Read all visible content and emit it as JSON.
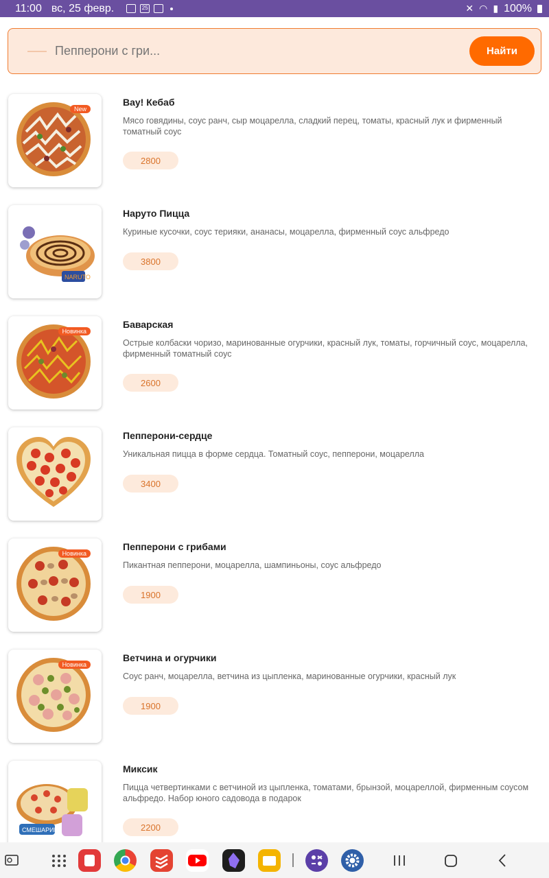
{
  "status": {
    "time": "11:00",
    "date": "вс, 25 февр.",
    "battery": "100%",
    "calendar_day": "25"
  },
  "search": {
    "placeholder": "Пепперони с гри...",
    "button_label": "Найти"
  },
  "products": [
    {
      "title": "Вау! Кебаб",
      "description": "Мясо говядины, соус ранч, сыр моцарелла, сладкий перец, томаты, красный лук и фирменный томатный соус",
      "price": "2800",
      "badge": "New",
      "image": "pizza-kebab"
    },
    {
      "title": "Наруто Пицца",
      "description": "Куриные кусочки, соус терияки, ананасы, моцарелла, фирменный соус альфредо",
      "price": "3800",
      "badge": "",
      "image": "pizza-naruto"
    },
    {
      "title": "Баварская",
      "description": "Острые колбаски чоризо, маринованные огурчики, красный лук, томаты, горчичный соус, моцарелла, фирменный томатный соус",
      "price": "2600",
      "badge": "Новинка",
      "image": "pizza-bavarian"
    },
    {
      "title": "Пепперони-сердце",
      "description": "Уникальная пицца в форме сердца. Томатный соус, пепперони, моцарелла",
      "price": "3400",
      "badge": "",
      "image": "pizza-heart"
    },
    {
      "title": "Пепперони с грибами",
      "description": "Пикантная пепперони, моцарелла, шампиньоны, соус альфредо",
      "price": "1900",
      "badge": "Новинка",
      "image": "pizza-pepperoni-mushroom"
    },
    {
      "title": "Ветчина и огурчики",
      "description": "Соус ранч, моцарелла, ветчина из цыпленка, маринованные огурчики, красный лук",
      "price": "1900",
      "badge": "Новинка",
      "image": "pizza-ham-pickles"
    },
    {
      "title": "Миксик",
      "description": "Пицца четвертинками с ветчиной из цыпленка, томатами, брынзой, моцареллой, фирменным соусом альфредо. Набор юного садовода в подарок",
      "price": "2200",
      "badge": "",
      "image": "pizza-miksik"
    }
  ],
  "nav": {
    "apps": [
      "recent-apps-icon",
      "app-drawer-icon",
      "notes-app-icon",
      "chrome-icon",
      "todoist-icon",
      "youtube-icon",
      "obsidian-icon",
      "files-icon",
      "apps-edge-icon",
      "settings-icon"
    ],
    "buttons": [
      "recents-button",
      "home-button",
      "back-button"
    ]
  },
  "colors": {
    "accent": "#ff6a00",
    "status_bar": "#6a4fa0",
    "price_bg": "#fdeadc",
    "badge": "#f25a22"
  }
}
